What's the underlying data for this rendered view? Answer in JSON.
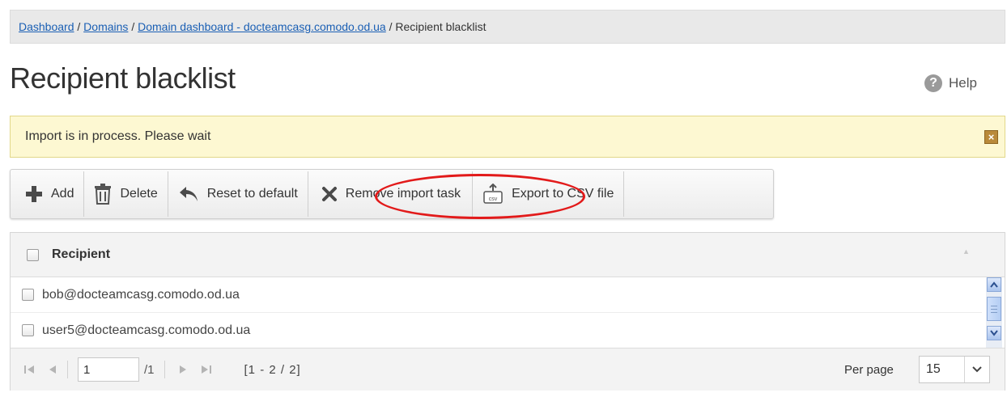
{
  "breadcrumb": {
    "items": [
      {
        "label": "Dashboard"
      },
      {
        "label": "Domains"
      },
      {
        "label": "Domain dashboard - docteamcasg.comodo.od.ua"
      }
    ],
    "current": "Recipient blacklist",
    "separator": "/"
  },
  "page": {
    "title": "Recipient blacklist"
  },
  "help": {
    "label": "Help",
    "icon": "question-icon"
  },
  "notice": {
    "text": "Import is in process. Please wait",
    "close_icon": "close-icon"
  },
  "toolbar": {
    "add": "Add",
    "delete": "Delete",
    "reset": "Reset to default",
    "remove_import": "Remove import task",
    "export_csv": "Export to CSV file",
    "csv_badge": "csv"
  },
  "grid": {
    "column": "Recipient",
    "rows": [
      {
        "email": "bob@docteamcasg.comodo.od.ua"
      },
      {
        "email": "user5@docteamcasg.comodo.od.ua"
      }
    ]
  },
  "pager": {
    "page": "1",
    "total": "/1",
    "range": "[1 - 2 / 2]",
    "per_page_label": "Per page",
    "per_page": "15"
  },
  "colors": {
    "link": "#1a5fb4",
    "notice_bg": "#fdf8d2",
    "highlight": "#e21a1a"
  }
}
